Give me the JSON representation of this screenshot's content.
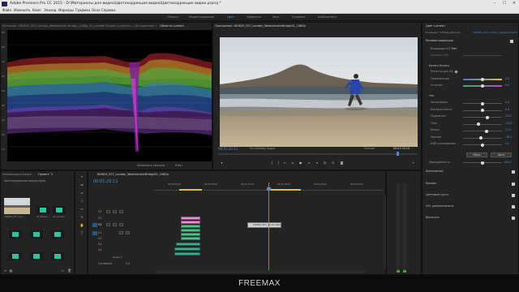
{
  "window": {
    "title": "Adobe Premiere Pro CC 2015 - D:\\Материалы для видео\\Цветокоррекция видео\\Цветокоррекция видео.prproj *",
    "controls": [
      "–",
      "☐",
      "✕"
    ]
  },
  "menu": [
    "Файл",
    "Изменить",
    "Клип",
    "Эпизод",
    "Маркеры",
    "Графика",
    "Окно",
    "Справка"
  ],
  "workspaces": {
    "items": [
      "Сборка",
      "Редактирование",
      "Цвет",
      "Эффекты",
      "Звук",
      "Графика",
      "Библиотеки"
    ],
    "active": "Цвет"
  },
  "source_panel": {
    "tab_label": "Источник: 160829_057_London_Westminster Bridge_1080p_03_Lumetri Scopes (Lumetri) — Метаданные: 00:00:00:00",
    "scopes_tab": "Области Lumetri",
    "scale_labels": [
      "90",
      "80",
      "70",
      "60",
      "50",
      "40",
      "30",
      "20",
      "10"
    ],
    "footer_label": "Затемнить пиксели",
    "footer_value": "8 бит"
  },
  "program_panel": {
    "tab_label": "Программа: 160829_057_London_WestminsterBridge01_1080p",
    "timecode_left": "00:01:20:11",
    "fit_label": "По размеру кадра",
    "quality_label": "Полное",
    "timecode_right": "00:01:29:10"
  },
  "lumetri": {
    "tab_label": "Цвет Lumetri",
    "header_left": "Основной * 1TEXAS_DSS_Ro...",
    "header_right": "160829_057_London_WestminsterBr...",
    "basic_section": "Базовая коррекция",
    "input_lut_label": "Входящая LUT",
    "input_lut_value": "Нет",
    "hdr_label": "Уровень HDR",
    "wb_section": "Баланс белого",
    "wb_picker_label": "Пипетка для ББ",
    "temperature_label": "Температура",
    "temperature_value": "0.0",
    "tint_label": "Оттенок",
    "tint_value": "0.0",
    "tone_section": "Тон",
    "tone_rows": [
      {
        "label": "Экспозиция",
        "value": "0.0",
        "pos": 0.5
      },
      {
        "label": "Контрастность",
        "value": "0.0",
        "pos": 0.5
      },
      {
        "label": "Подсветка",
        "value": "25.0",
        "pos": 0.63
      },
      {
        "label": "Тени",
        "value": "-20.0",
        "pos": 0.4
      },
      {
        "label": "Белые",
        "value": "21.0",
        "pos": 0.6
      },
      {
        "label": "Черные",
        "value": "-10.0",
        "pos": 0.45
      },
      {
        "label": "HDR и отражения",
        "value": "0.0",
        "pos": 0.5
      }
    ],
    "reset_button": "Сброс",
    "auto_button": "Авто",
    "saturation_label": "Насыщенность",
    "saturation_value": "100.0",
    "sections": [
      "Креативный",
      "Кривые",
      "Цветовые круги",
      "HSL дополнительно",
      "Виньетка"
    ]
  },
  "project_panel": {
    "tab_label": "Информация видео",
    "tab_active": "Проект: 3",
    "project_name": "Цветокоррекция видео.prproj",
    "thumb_labels": [
      "160829_057_Lon...",
      "02_Rocks...",
      "01_Sunset...",
      "",
      "",
      ""
    ]
  },
  "timeline": {
    "tab_label": "160829_057_London_WestminsterBridge01_1080p",
    "timecode": "00:01:20:11",
    "ruler_labels": [
      "00:00:45:00",
      "00:01:00:00",
      "00:01:15:00",
      "00:01:30:00",
      "00:01:45:00",
      "00:02:00:00"
    ],
    "video_tracks": [
      "V3",
      "V2",
      "V1"
    ],
    "audio_tracks": [
      "A1",
      "A2",
      "A3",
      "A4"
    ],
    "master_label": "Основной",
    "master_value": "0.0",
    "clip_label": "160829_057_London_WestminsterBr...",
    "track_sub_label": "Видео 1"
  },
  "watermark": "FREEMAX",
  "colors": {
    "accent": "#4a90e2",
    "clip_pink": "#e38fd0",
    "clip_green": "#4fc28c",
    "clip_teal": "#3da98f"
  }
}
